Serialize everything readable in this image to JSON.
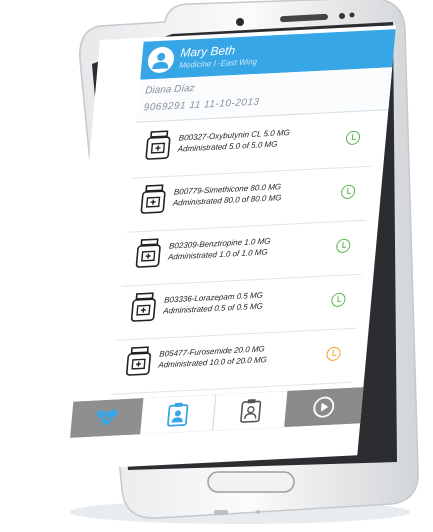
{
  "header": {
    "name": "Mary Beth",
    "subtitle": "Medicine I -East Wing"
  },
  "patient": {
    "name": "Diana Díaz",
    "info": "9069291  11  11-10-2013"
  },
  "medications": [
    {
      "title": "B00327-Oxybutynin CL 5.0 MG",
      "admin": "Administrated 5.0 of 5.0 MG",
      "status": "ok"
    },
    {
      "title": "B00779-Simethicone 80.0 MG",
      "admin": "Administrated 80.0 of 80.0 MG",
      "status": "ok"
    },
    {
      "title": "B02309-Benztropine  1.0 MG",
      "admin": "Administrated 1.0 of 1.0 MG",
      "status": "ok"
    },
    {
      "title": "B03336-Lorazepam 0.5 MG",
      "admin": "Administrated 0.5 of 0.5 MG",
      "status": "ok"
    },
    {
      "title": "B05477-Furosemide 20.0 MG",
      "admin": "Administrated 10.0 of 20.0 MG",
      "status": "warn"
    }
  ],
  "colors": {
    "header": "#36a6e6",
    "ok": "#58b84b",
    "warn": "#f0a324",
    "tabbar": "#8f8f8f"
  },
  "tabs": [
    {
      "icon": "heart-pulse-icon"
    },
    {
      "icon": "user-badge-icon"
    },
    {
      "icon": "clipboard-user-icon"
    },
    {
      "icon": "play-circle-icon"
    }
  ]
}
